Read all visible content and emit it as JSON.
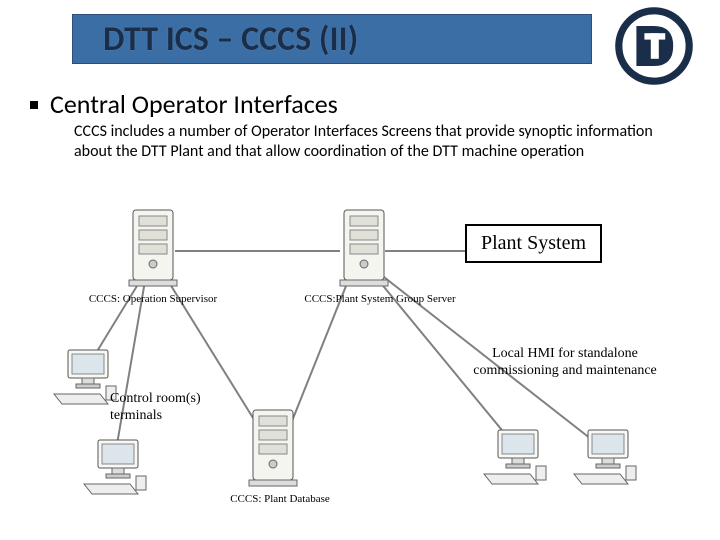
{
  "header": {
    "title": "DTT ICS – CCCS (II)"
  },
  "heading": "Central Operator Interfaces",
  "body": "CCCS includes a number of Operator Interfaces Screens that provide synoptic information about the DTT Plant and that allow coordination of the DTT machine operation",
  "diagram": {
    "plant_system_label": "Plant System",
    "nodes": {
      "supervisor": "CCCS: Operation Supervisor",
      "group_server": "CCCS:Plant System Group Server",
      "plant_db": "CCCS: Plant Database",
      "terminals": "Control room(s) terminals",
      "local_hmi": "Local HMI for standalone commissioning and maintenance"
    }
  }
}
